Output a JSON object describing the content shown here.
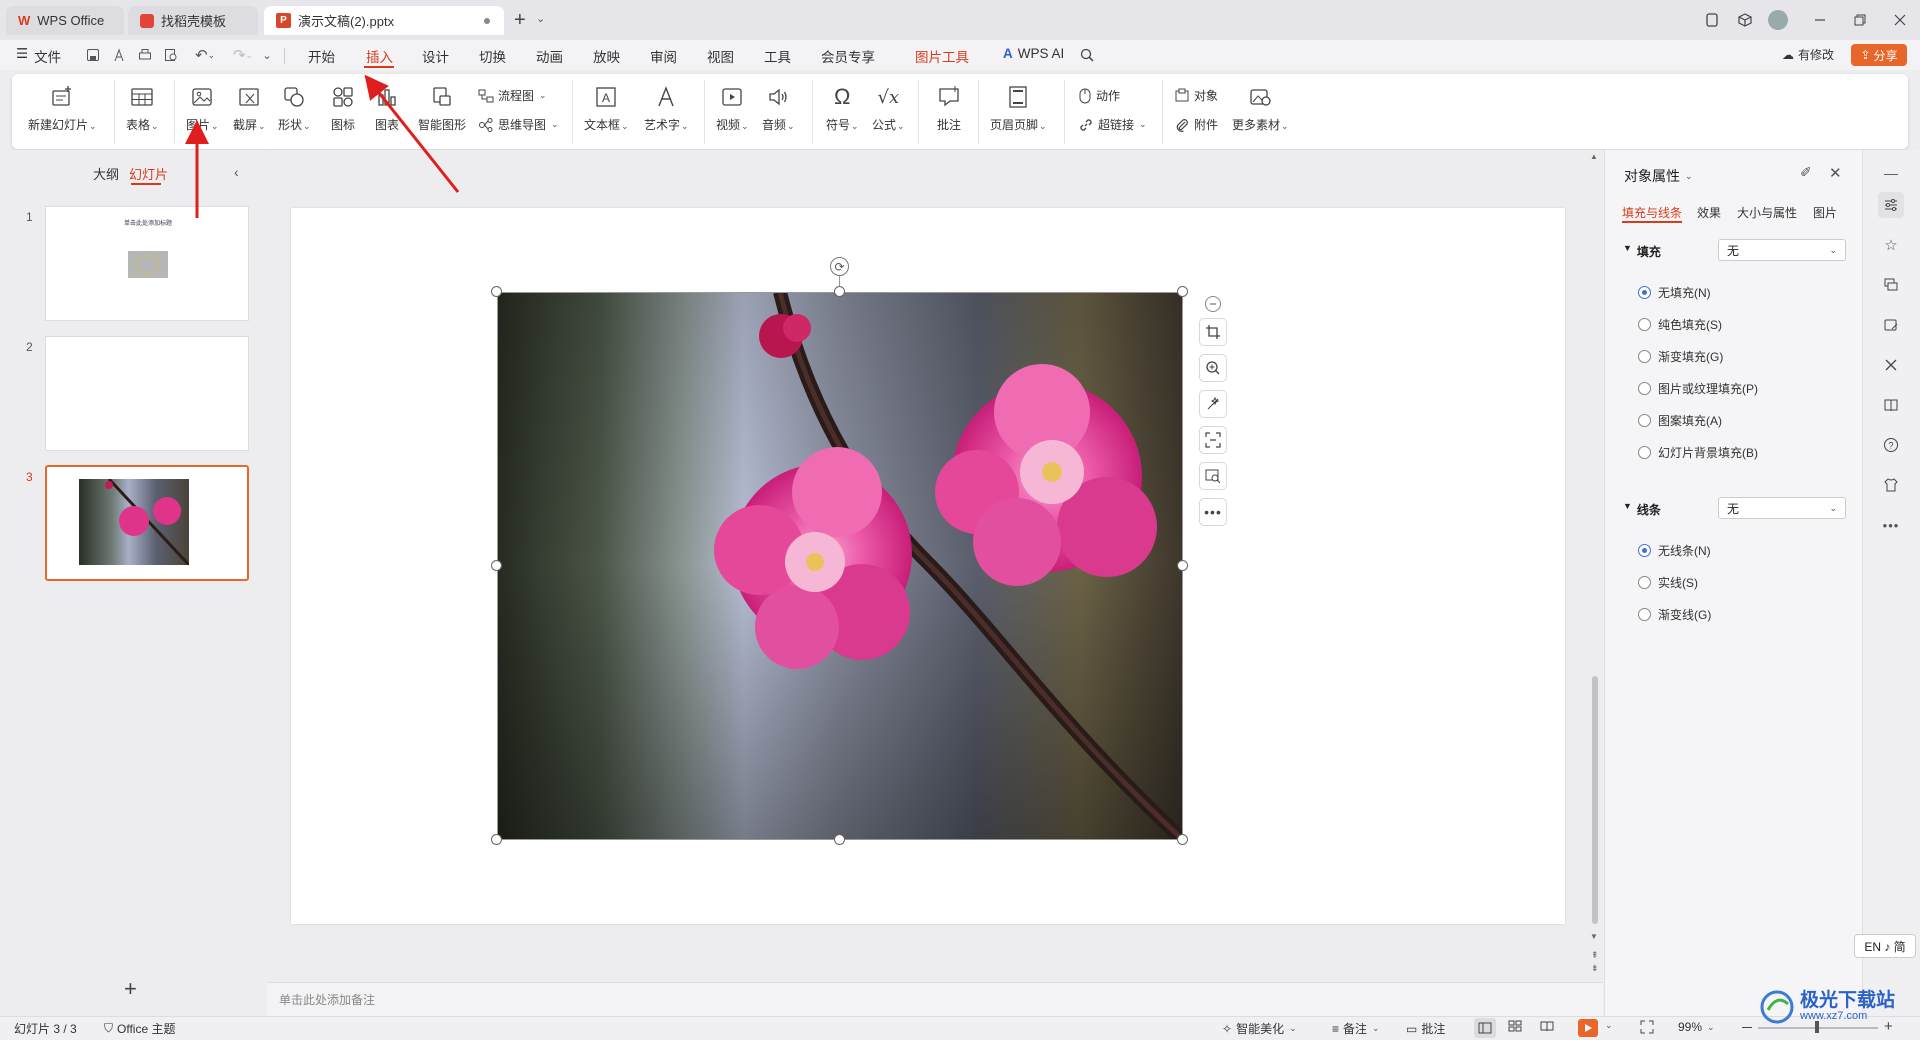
{
  "titlebar": {
    "tabs": [
      {
        "label": "WPS Office"
      },
      {
        "label": "找稻壳模板"
      },
      {
        "label": "演示文稿(2).pptx"
      }
    ]
  },
  "menubar": {
    "file": "文件",
    "items": [
      "开始",
      "插入",
      "设计",
      "切换",
      "动画",
      "放映",
      "审阅",
      "视图",
      "工具",
      "会员专享"
    ],
    "context_tab": "图片工具",
    "ai": "WPS AI",
    "modify": "有修改",
    "share": "分享"
  },
  "ribbon": {
    "new_slide": "新建幻灯片",
    "table": "表格",
    "picture": "图片",
    "screenshot": "截屏",
    "shape": "形状",
    "icon": "图标",
    "chart": "图表",
    "smart_graphic": "智能图形",
    "flowchart": "流程图",
    "mindmap": "思维导图",
    "textbox": "文本框",
    "art_text": "艺术字",
    "video": "视频",
    "audio": "音频",
    "symbol": "符号",
    "formula": "公式",
    "comment": "批注",
    "header_footer": "页眉页脚",
    "action": "动作",
    "hyperlink": "超链接",
    "object": "对象",
    "attachment": "附件",
    "more_materials": "更多素材"
  },
  "leftpanel": {
    "tab_outline": "大纲",
    "tab_slides": "幻灯片",
    "slides": [
      {
        "number": "1",
        "title": "单击此处添加标题"
      },
      {
        "number": "2"
      },
      {
        "number": "3"
      }
    ],
    "add": "+"
  },
  "notes": {
    "placeholder": "单击此处添加备注"
  },
  "rightpanel": {
    "title": "对象属性",
    "tabs": [
      "填充与线条",
      "效果",
      "大小与属性",
      "图片"
    ],
    "fill": {
      "heading": "填充",
      "value": "无",
      "options": [
        "无填充(N)",
        "纯色填充(S)",
        "渐变填充(G)",
        "图片或纹理填充(P)",
        "图案填充(A)",
        "幻灯片背景填充(B)"
      ],
      "selected": 0
    },
    "line": {
      "heading": "线条",
      "value": "无",
      "options": [
        "无线条(N)",
        "实线(S)",
        "渐变线(G)"
      ],
      "selected": 0
    }
  },
  "ime": "EN ♪ 简",
  "statusbar": {
    "slide_count": "幻灯片 3 / 3",
    "theme": "Office 主题",
    "beautify": "智能美化",
    "notes": "备注",
    "comment": "批注",
    "zoom": "99%"
  },
  "watermark": {
    "name": "极光下载站",
    "url": "www.xz7.com"
  },
  "colors": {
    "accent": "#d63c1c",
    "share_bg": "#e8662a",
    "selection": "#e8662a",
    "radio": "#3c6fd8"
  }
}
